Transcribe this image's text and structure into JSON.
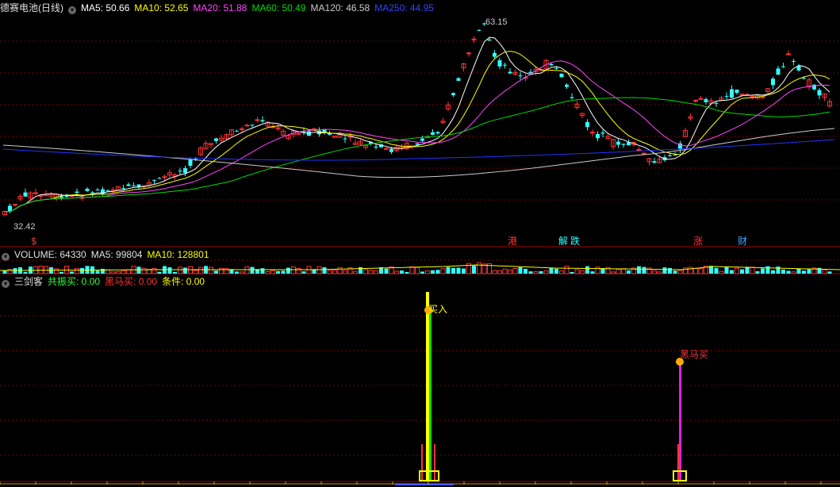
{
  "main_panel": {
    "title": "德赛电池(日线)",
    "ma": [
      {
        "label": "MA5: 50.66",
        "color": "#ffffff"
      },
      {
        "label": "MA10: 52.65",
        "color": "#ffff00"
      },
      {
        "label": "MA20: 51.88",
        "color": "#ff44ff"
      },
      {
        "label": "MA60: 50.49",
        "color": "#00dd00"
      },
      {
        "label": "MA120: 46.58",
        "color": "#cccccc"
      },
      {
        "label": "MA250: 44.95",
        "color": "#2233ff"
      }
    ],
    "high_label": "63.15",
    "low_label": "32.42",
    "event_markers": [
      {
        "text": "$",
        "color": "#ff3333"
      },
      {
        "text": "港",
        "color": "#ff3333"
      },
      {
        "text": "解",
        "color": "#33ffff"
      },
      {
        "text": "跌",
        "color": "#33ffff"
      },
      {
        "text": "涨",
        "color": "#ff3333"
      },
      {
        "text": "财",
        "color": "#33aaff"
      }
    ]
  },
  "volume_panel": {
    "title": "VOLUME: 64330",
    "ma5": "MA5: 99804",
    "ma10": "MA10: 128801"
  },
  "indicator_panel": {
    "title": "三剑客",
    "resonance": "共振买: 0.00",
    "darkhorse": "黑马买: 0.00",
    "condition": "条件: 0.00",
    "signal_buy": "买入",
    "signal_darkhorse": "黑马买"
  },
  "colors": {
    "up": "#ff3333",
    "down": "#33ffff",
    "grid": "#7a0000",
    "border": "#a00000"
  }
}
